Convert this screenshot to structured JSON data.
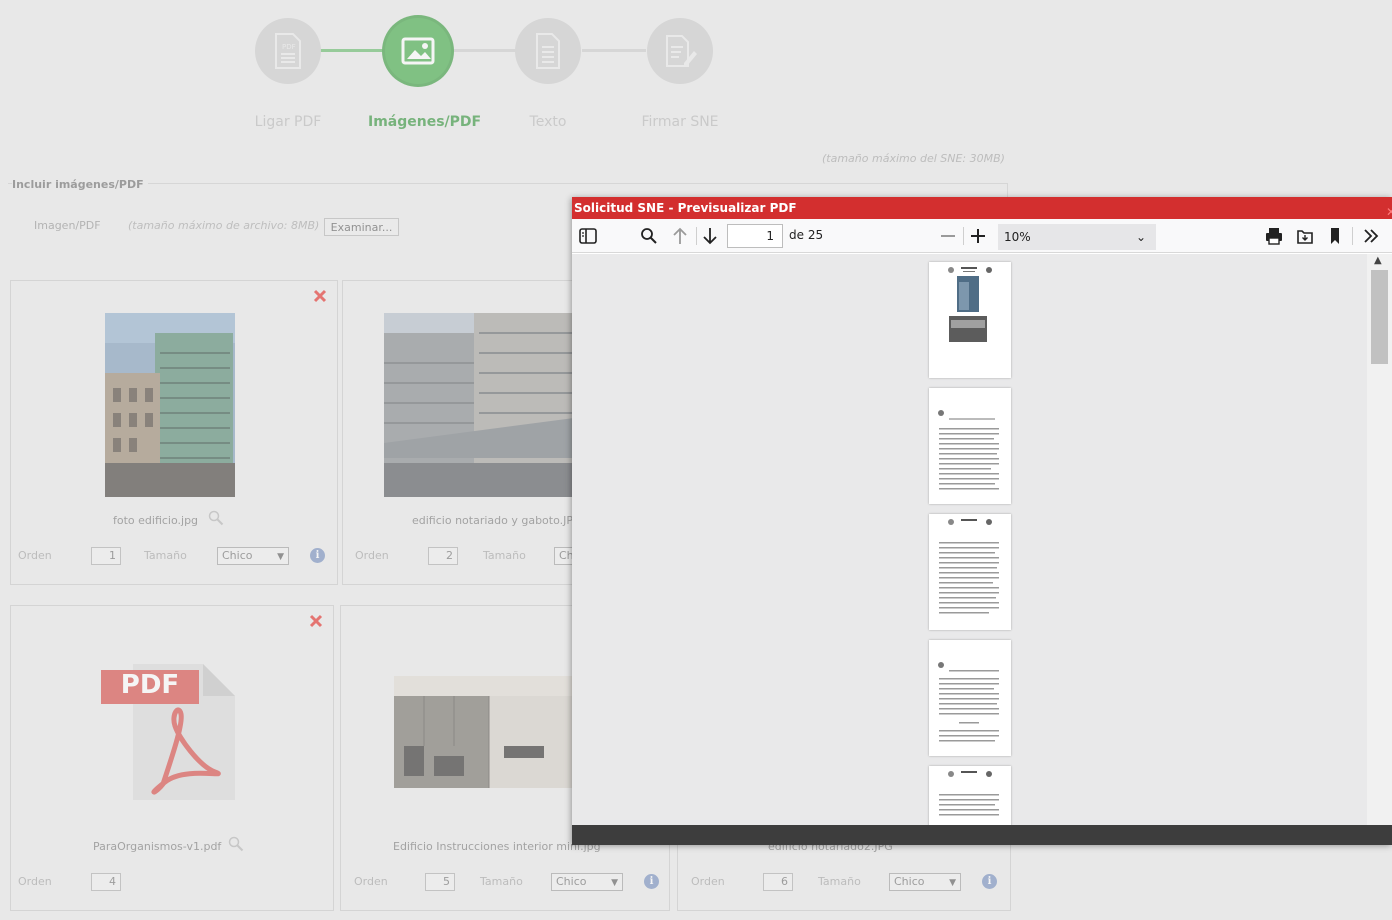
{
  "steps": [
    {
      "label": "Ligar PDF",
      "active": false
    },
    {
      "label": "Imágenes/PDF",
      "active": true
    },
    {
      "label": "Texto",
      "active": false
    },
    {
      "label": "Firmar SNE",
      "active": false
    }
  ],
  "max_sne_note": "(tamaño máximo del SNE: 30MB)",
  "include_section": {
    "legend": "Incluir imágenes/PDF",
    "file_label": "Imagen/PDF",
    "file_note": "(tamaño máximo de archivo: 8MB)",
    "browse_label": "Examinar..."
  },
  "labels": {
    "order": "Orden",
    "size": "Tamaño"
  },
  "cards": [
    {
      "name": "foto edificio.jpg",
      "order": "1",
      "size": "Chico"
    },
    {
      "name": "edificio notariado y gaboto.JPG",
      "order": "2",
      "size": "Chico"
    },
    {
      "name": "ParaOrganismos-v1.pdf",
      "order": "4"
    },
    {
      "name": "Edificio Instrucciones interior mini.jpg",
      "order": "5",
      "size": "Chico"
    },
    {
      "name": "edificio notariado2.JPG",
      "order": "6",
      "size": "Chico"
    }
  ],
  "pdf_badge": "PDF",
  "modal": {
    "title": "Solicitud SNE - Previsualizar PDF",
    "page_current": "1",
    "page_of": "de 25",
    "zoom": "10%"
  },
  "colors": {
    "accent_green": "#4caf50",
    "modal_title": "#d32f2f",
    "close_red": "#e53935"
  }
}
